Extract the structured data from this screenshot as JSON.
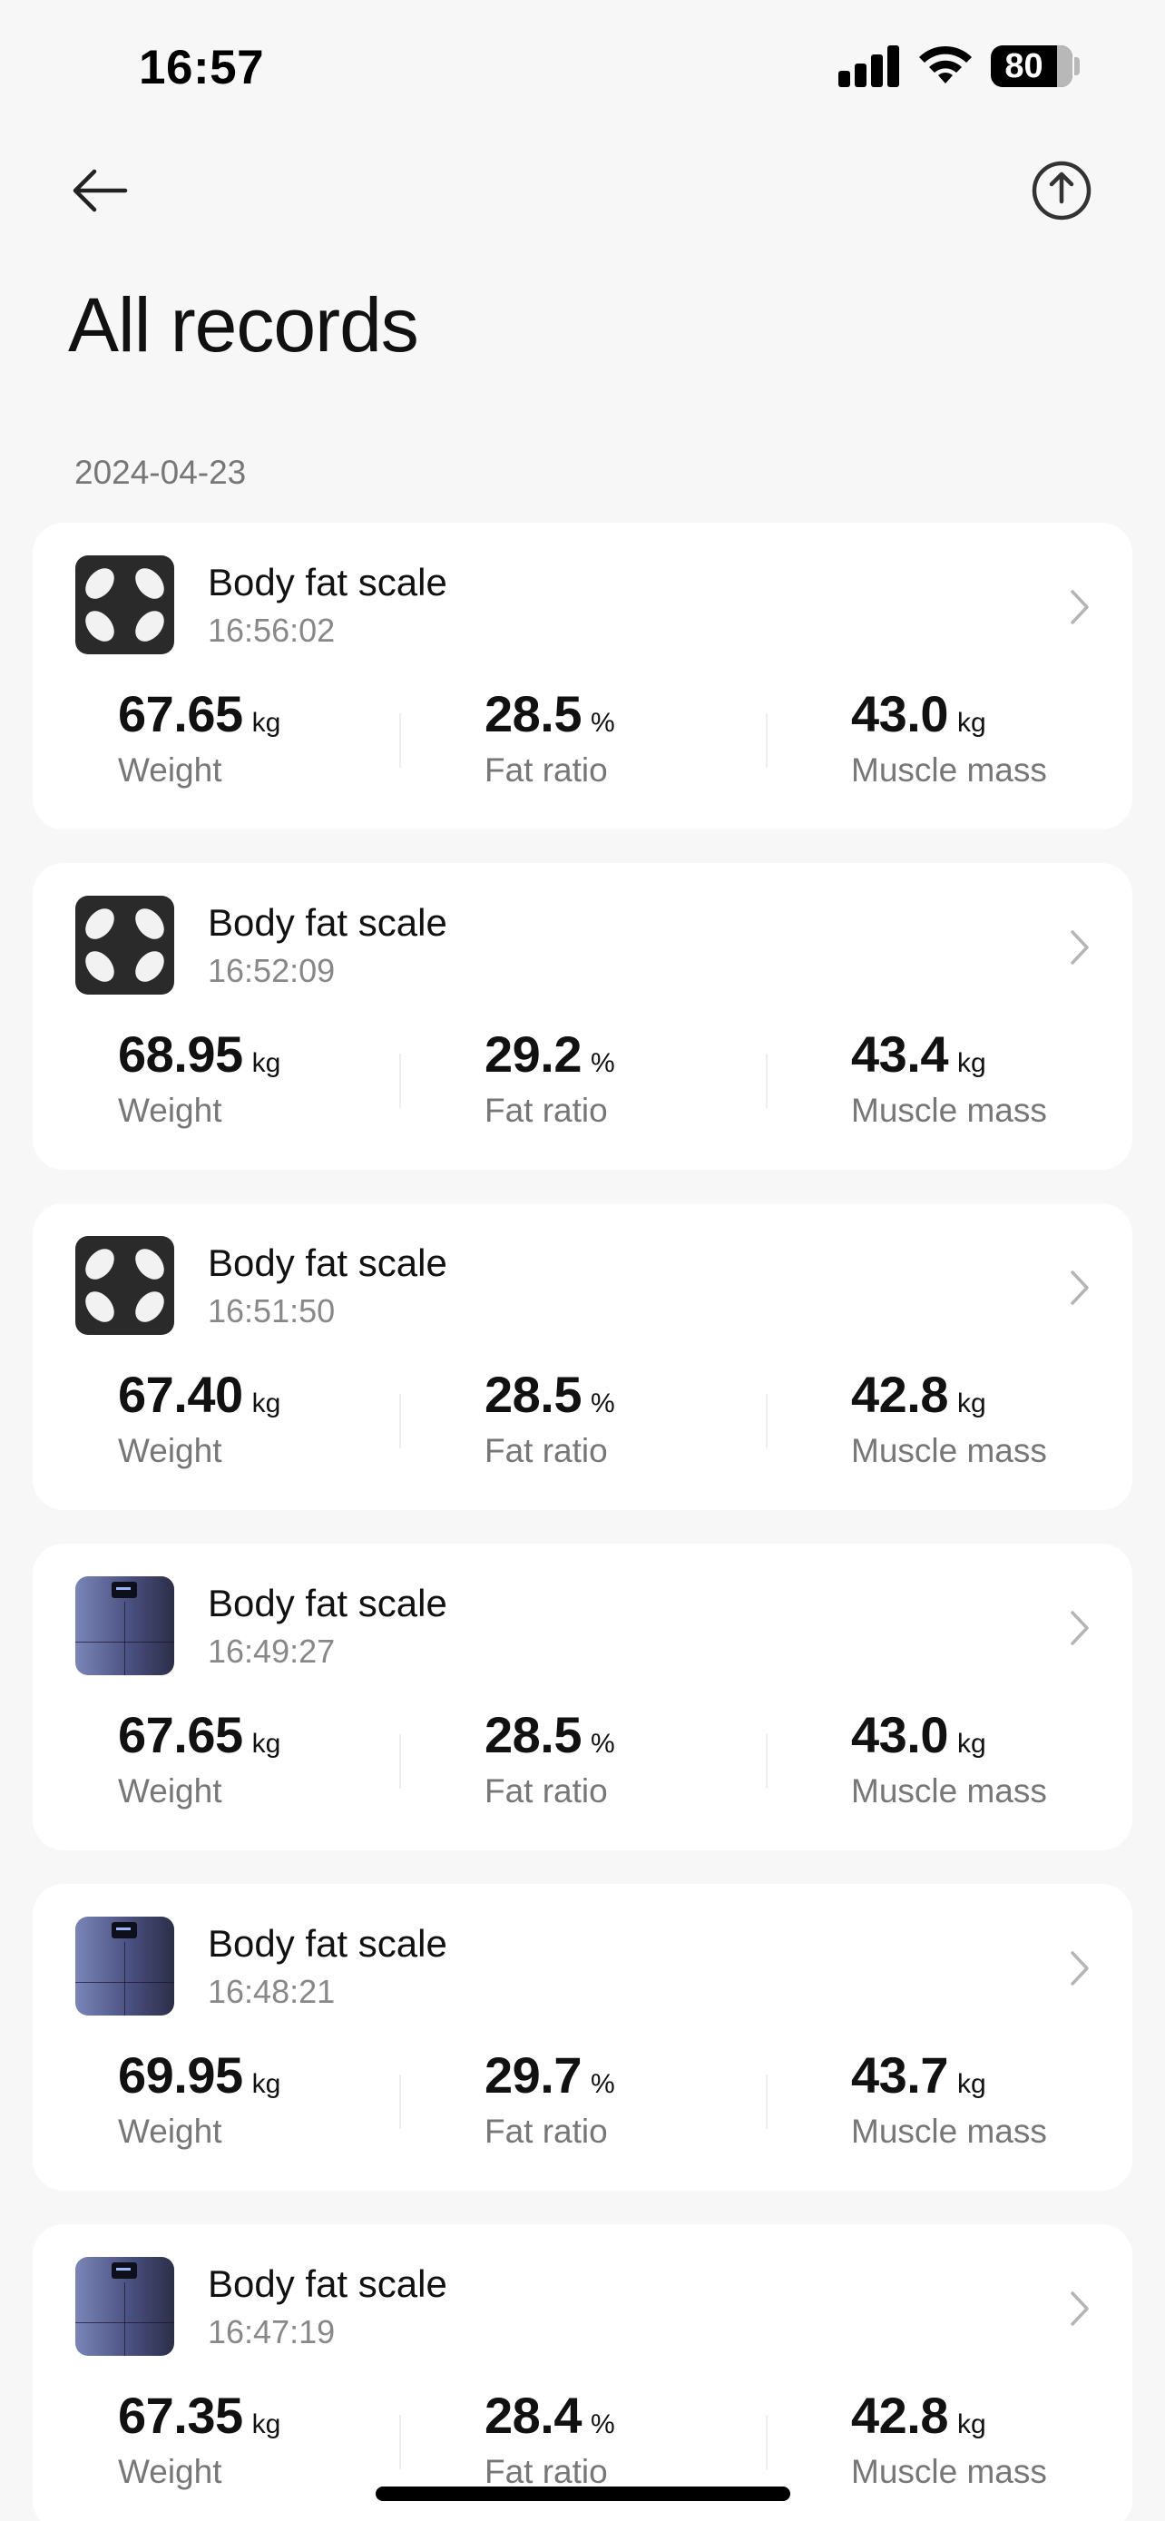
{
  "status_bar": {
    "time": "16:57",
    "battery": "80"
  },
  "nav": {
    "back_icon": "arrow-left-icon",
    "share_icon": "share-upload-icon"
  },
  "page": {
    "title": "All records"
  },
  "groups": [
    {
      "date": "2024-04-23"
    }
  ],
  "records": [
    {
      "device": "Body fat scale",
      "device_icon": "scale-dark-icon",
      "time": "16:56:02",
      "weight": {
        "value": "67.65",
        "unit": "kg",
        "label": "Weight"
      },
      "fat": {
        "value": "28.5",
        "unit": "%",
        "label": "Fat ratio"
      },
      "muscle": {
        "value": "43.0",
        "unit": "kg",
        "label": "Muscle mass"
      }
    },
    {
      "device": "Body fat scale",
      "device_icon": "scale-dark-icon",
      "time": "16:52:09",
      "weight": {
        "value": "68.95",
        "unit": "kg",
        "label": "Weight"
      },
      "fat": {
        "value": "29.2",
        "unit": "%",
        "label": "Fat ratio"
      },
      "muscle": {
        "value": "43.4",
        "unit": "kg",
        "label": "Muscle mass"
      }
    },
    {
      "device": "Body fat scale",
      "device_icon": "scale-dark-icon",
      "time": "16:51:50",
      "weight": {
        "value": "67.40",
        "unit": "kg",
        "label": "Weight"
      },
      "fat": {
        "value": "28.5",
        "unit": "%",
        "label": "Fat ratio"
      },
      "muscle": {
        "value": "42.8",
        "unit": "kg",
        "label": "Muscle mass"
      }
    },
    {
      "device": "Body fat scale",
      "device_icon": "scale-blue-icon",
      "time": "16:49:27",
      "weight": {
        "value": "67.65",
        "unit": "kg",
        "label": "Weight"
      },
      "fat": {
        "value": "28.5",
        "unit": "%",
        "label": "Fat ratio"
      },
      "muscle": {
        "value": "43.0",
        "unit": "kg",
        "label": "Muscle mass"
      }
    },
    {
      "device": "Body fat scale",
      "device_icon": "scale-blue-icon",
      "time": "16:48:21",
      "weight": {
        "value": "69.95",
        "unit": "kg",
        "label": "Weight"
      },
      "fat": {
        "value": "29.7",
        "unit": "%",
        "label": "Fat ratio"
      },
      "muscle": {
        "value": "43.7",
        "unit": "kg",
        "label": "Muscle mass"
      }
    },
    {
      "device": "Body fat scale",
      "device_icon": "scale-blue-icon",
      "time": "16:47:19",
      "weight": {
        "value": "67.35",
        "unit": "kg",
        "label": "Weight"
      },
      "fat": {
        "value": "28.4",
        "unit": "%",
        "label": "Fat ratio"
      },
      "muscle": {
        "value": "42.8",
        "unit": "kg",
        "label": "Muscle mass"
      }
    }
  ],
  "colors": {
    "background": "#f7f7f7",
    "card": "#ffffff",
    "primary_text": "#111111",
    "secondary_text": "#777777"
  }
}
